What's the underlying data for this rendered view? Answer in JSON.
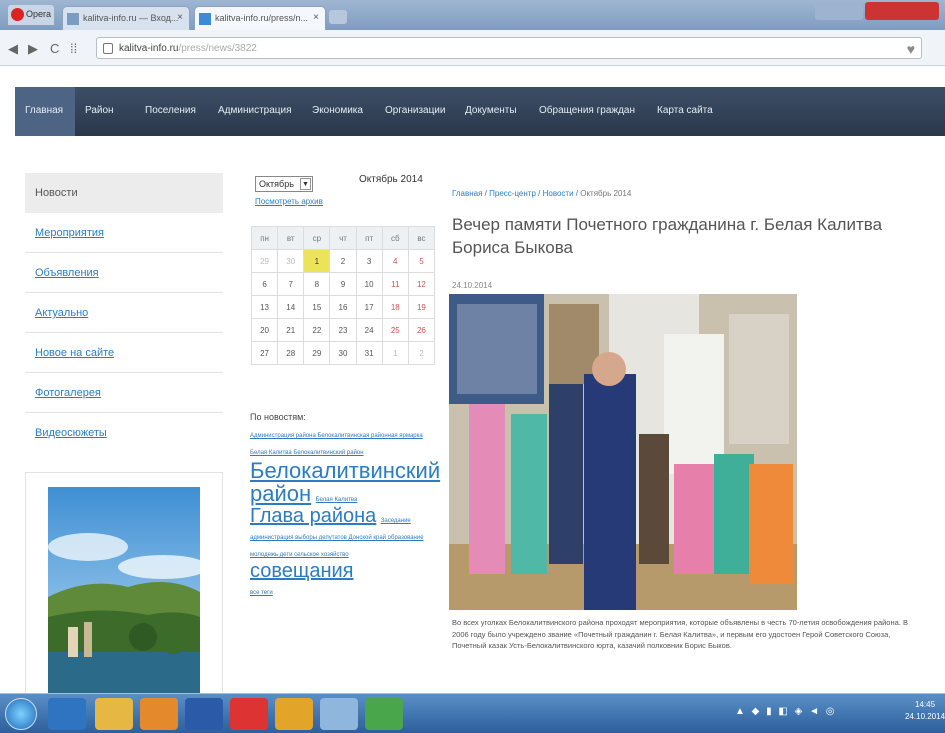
{
  "browser": {
    "menu_label": "Opera",
    "tabs": [
      {
        "label": "kalitva-info.ru — Вход..."
      },
      {
        "label": "kalitva-info.ru/press/n..."
      }
    ],
    "address": {
      "host": "kalitva-info.ru",
      "path": "/press/news/3822"
    },
    "nav": {
      "back": "◀",
      "forward": "▶",
      "reload": "C",
      "speeddial": "⁞⁞"
    }
  },
  "site_nav": {
    "items": [
      "Главная",
      "Район",
      "Поселения",
      "Администрация",
      "Экономика",
      "Организации",
      "Документы",
      "Обращения граждан",
      "Карта сайта"
    ]
  },
  "sidebar": {
    "header": "Новости",
    "items": [
      "Мероприятия",
      "Объявления",
      "Актуально",
      "Новое на сайте",
      "Фотогалерея",
      "Видеосюжеты"
    ]
  },
  "calendar": {
    "select_value": "Октябрь",
    "title": "Октябрь 2014",
    "link": "Посмотреть архив",
    "days_of_week": [
      "пн",
      "вт",
      "ср",
      "чт",
      "пт",
      "сб",
      "вс"
    ],
    "weeks": [
      [
        "29",
        "30",
        "1",
        "2",
        "3",
        "4",
        "5"
      ],
      [
        "6",
        "7",
        "8",
        "9",
        "10",
        "11",
        "12"
      ],
      [
        "13",
        "14",
        "15",
        "16",
        "17",
        "18",
        "19"
      ],
      [
        "20",
        "21",
        "22",
        "23",
        "24",
        "25",
        "26"
      ],
      [
        "27",
        "28",
        "29",
        "30",
        "31",
        "1",
        "2"
      ]
    ]
  },
  "tags": {
    "title": "По новостям:",
    "small1": "Администрация района Белокалитвинская районная ярмарка Белая Калитва Белокалитвинский район",
    "big1": "Белокалитвинский район",
    "small2": "Белая Калитва",
    "big2": "Глава района",
    "small3": "Заседание администрация выборы депутатов Донской край образование молодежь дети сельское хозяйство",
    "big3": "совещания",
    "small4": "все теги"
  },
  "article": {
    "breadcrumbs": [
      "Главная",
      "Пресс-центр",
      "Новости",
      "Октябрь 2014"
    ],
    "title": "Вечер памяти Почетного гражданина г. Белая Калитва Бориса Быкова",
    "date": "24.10.2014",
    "text": "Во всех уголках Белокалитвинского района проходят мероприятия, которые объявлены в честь 70-летия освобождения района. В 2006 году было учреждено звание «Почетный гражданин г. Белая Калитва», и первым его удостоен Герой Советского Союза, Почетный казак Усть-Белокалитвинского юрта, казачий полковник Борис Быков."
  },
  "taskbar": {
    "time": "14:45",
    "date": "24.10.2014",
    "tray": "▲ ◆ ▮ ◧ ◈ ◄ ◎"
  },
  "colors": {
    "nav_bg": "#2f3f55",
    "link": "#2d7cc2",
    "calendar_today": "#ede35a",
    "taskbar": "#3d6fa8"
  }
}
